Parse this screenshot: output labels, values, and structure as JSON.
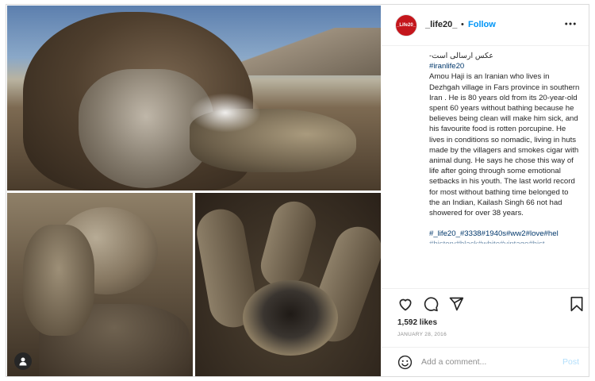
{
  "header": {
    "avatar_text": "_Life20_",
    "username": "_life20_",
    "separator": "•",
    "follow_label": "Follow"
  },
  "caption": {
    "line_fa": "عکس ارسالی است-",
    "hashtag1": "#iranlife20",
    "body": "Amou Haji is an Iranian who lives in Dezhgah village in Fars province in southern Iran . He is 80 years old from its 20-year-old spent 60 years without bathing because he believes being clean will make him sick, and his favourite food is rotten porcupine. He lives in conditions so nomadic, living in huts made by the villagers and smokes cigar with animal dung. He says he chose this way of life after going through some emotional setbacks in his youth. The last world record for most without bathing time belonged to the an Indian, Kailash Singh 66 not had showered for over 38 years.",
    "hashtags": "#_life20_#3338#1940s#ww2#love#hel",
    "cut_line": "#history#black#white#vintage#hist"
  },
  "stats": {
    "likes": "1,592 likes",
    "date": "JANUARY 28, 2016"
  },
  "comment_box": {
    "placeholder": "Add a comment...",
    "post_label": "Post"
  },
  "colors": {
    "accent": "#0095f6",
    "avatar_bg": "#c4161c",
    "hashtag": "#00376b"
  },
  "icons": [
    "more-options-icon",
    "heart-icon",
    "comment-icon",
    "share-icon",
    "bookmark-icon",
    "emoji-icon",
    "user-tag-icon"
  ]
}
